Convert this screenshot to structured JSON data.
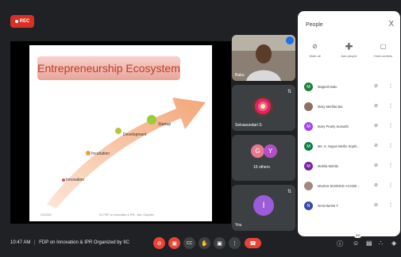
{
  "rec_label": "REC",
  "slide": {
    "title": "Entrepreneurship Ecosystem",
    "stages": [
      "Innovation",
      "Incubation",
      "Development",
      "Startup"
    ],
    "footer_left": "2/3/2023",
    "footer_right": "IIC FDP on Innovation & IPR - Mrs. Gayathri"
  },
  "tiles": {
    "presenter_name": "Babu",
    "participant_name": "Selvasundari S",
    "others_initials": [
      "G",
      "Y"
    ],
    "others_label": "16 others",
    "you_initial": "I",
    "you_label": "You"
  },
  "panel": {
    "title": "People",
    "close_glyph": "X",
    "actions": [
      {
        "icon": "mute-all-icon",
        "label": "Mute all"
      },
      {
        "icon": "add-people-icon",
        "label": "Add people"
      },
      {
        "icon": "host-controls-icon",
        "label": "Host controls"
      }
    ],
    "participants": [
      {
        "initial": "M",
        "name": "Magesh Balu",
        "color": "#188038"
      },
      {
        "initial": "",
        "name": "Mary Merlitta Bai",
        "color": "#8d6e63"
      },
      {
        "initial": "M",
        "name": "Mary Pearly Sumathi",
        "color": "#a142f4"
      },
      {
        "initial": "M",
        "name": "Ms. S. Sayan Merlin Sophi...",
        "color": "#0b8043"
      },
      {
        "initial": "M",
        "name": "Muhila Muhila",
        "color": "#7b1fa2"
      },
      {
        "initial": "",
        "name": "MUZUs SCIENCE ACADE...",
        "color": "#a1887f"
      },
      {
        "initial": "N",
        "name": "NAGAMANI T",
        "color": "#3949ab"
      }
    ]
  },
  "bottom": {
    "time": "10:47 AM",
    "separator": "|",
    "meeting_title": "FDP on Innovation & IPR Organized by IIC",
    "participant_count": "100"
  },
  "colors": {
    "background": "#202124",
    "danger": "#ea4335",
    "panel": "#ffffff",
    "arrow": "#f4b183"
  }
}
